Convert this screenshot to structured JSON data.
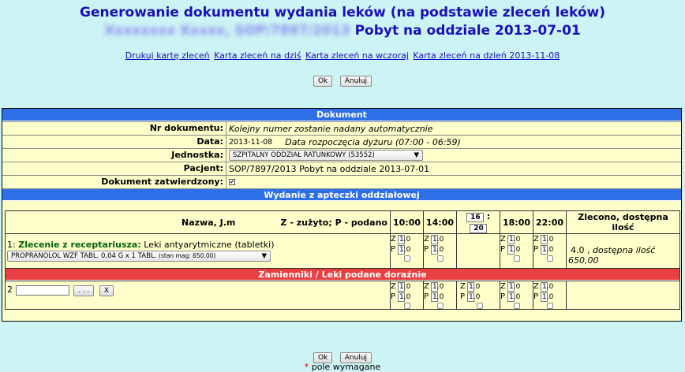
{
  "header": {
    "title": "Generowanie dokumentu wydania leków (na podstawie zleceń leków)",
    "patient_blurred": "Xxxxxxxx Xxxxx, SOP/7897/2013",
    "stay": "Pobyt na oddziale 2013-07-01"
  },
  "links": [
    "Drukuj kartę zleceń",
    "Karta zleceń na dziś",
    "Karta zleceń na wczoraj",
    "Karta zleceń na dzień 2013-11-08"
  ],
  "buttons": {
    "ok": "Ok",
    "cancel": "Anuluj"
  },
  "document": {
    "section_title": "Dokument",
    "fields": {
      "number_label": "Nr dokumentu:",
      "number_value": "Kolejny numer zostanie nadany automatycznie",
      "date_label": "Data:",
      "date_value": "2013-11-08",
      "date_note": "Data rozpoczęcia dyżuru (07:00 - 06:59)",
      "unit_label": "Jednostka:",
      "unit_value": "SZPITALNY ODDZIAŁ RATUNKOWY (53552)",
      "patient_label": "Pacjent:",
      "patient_value": "SOP/7897/2013 Pobyt na oddziale 2013-07-01",
      "approved_label": "Dokument zatwierdzony:"
    }
  },
  "issue": {
    "section_title": "Wydanie z apteczki oddziałowej",
    "columns": {
      "name": "Nazwa, J.m",
      "zp": "Z - zużyto; P - podano",
      "t1": "10:00",
      "t2": "14:00",
      "custom_h": "16",
      "custom_sep": ":",
      "custom_m": "20",
      "t4": "18:00",
      "t5": "22:00",
      "ordered": "Zlecono, dostępna ilość"
    },
    "order": {
      "index": "1:",
      "label": "Zlecenie z receptariusza:",
      "desc": "Leki antyarytmiczne (tabletki)",
      "drug": "PROPRANOLOL WZF TABL. 0,04 G x 1 TABL.",
      "stock": "(stan mag: 650,00)",
      "ordered_value": "4.0 ,",
      "available_label": "dostępna ilość",
      "available_value": "650,00"
    },
    "z_letter": "Z",
    "p_letter": "P",
    "qty": "1.0",
    "substitutes_title": "Zamienniki / Leki podane doraźnie",
    "substitute": {
      "index": "2",
      "browse": ". . .",
      "clear": "X"
    }
  },
  "footer": {
    "required_mark": "*",
    "required_text": "pole wymagane"
  }
}
